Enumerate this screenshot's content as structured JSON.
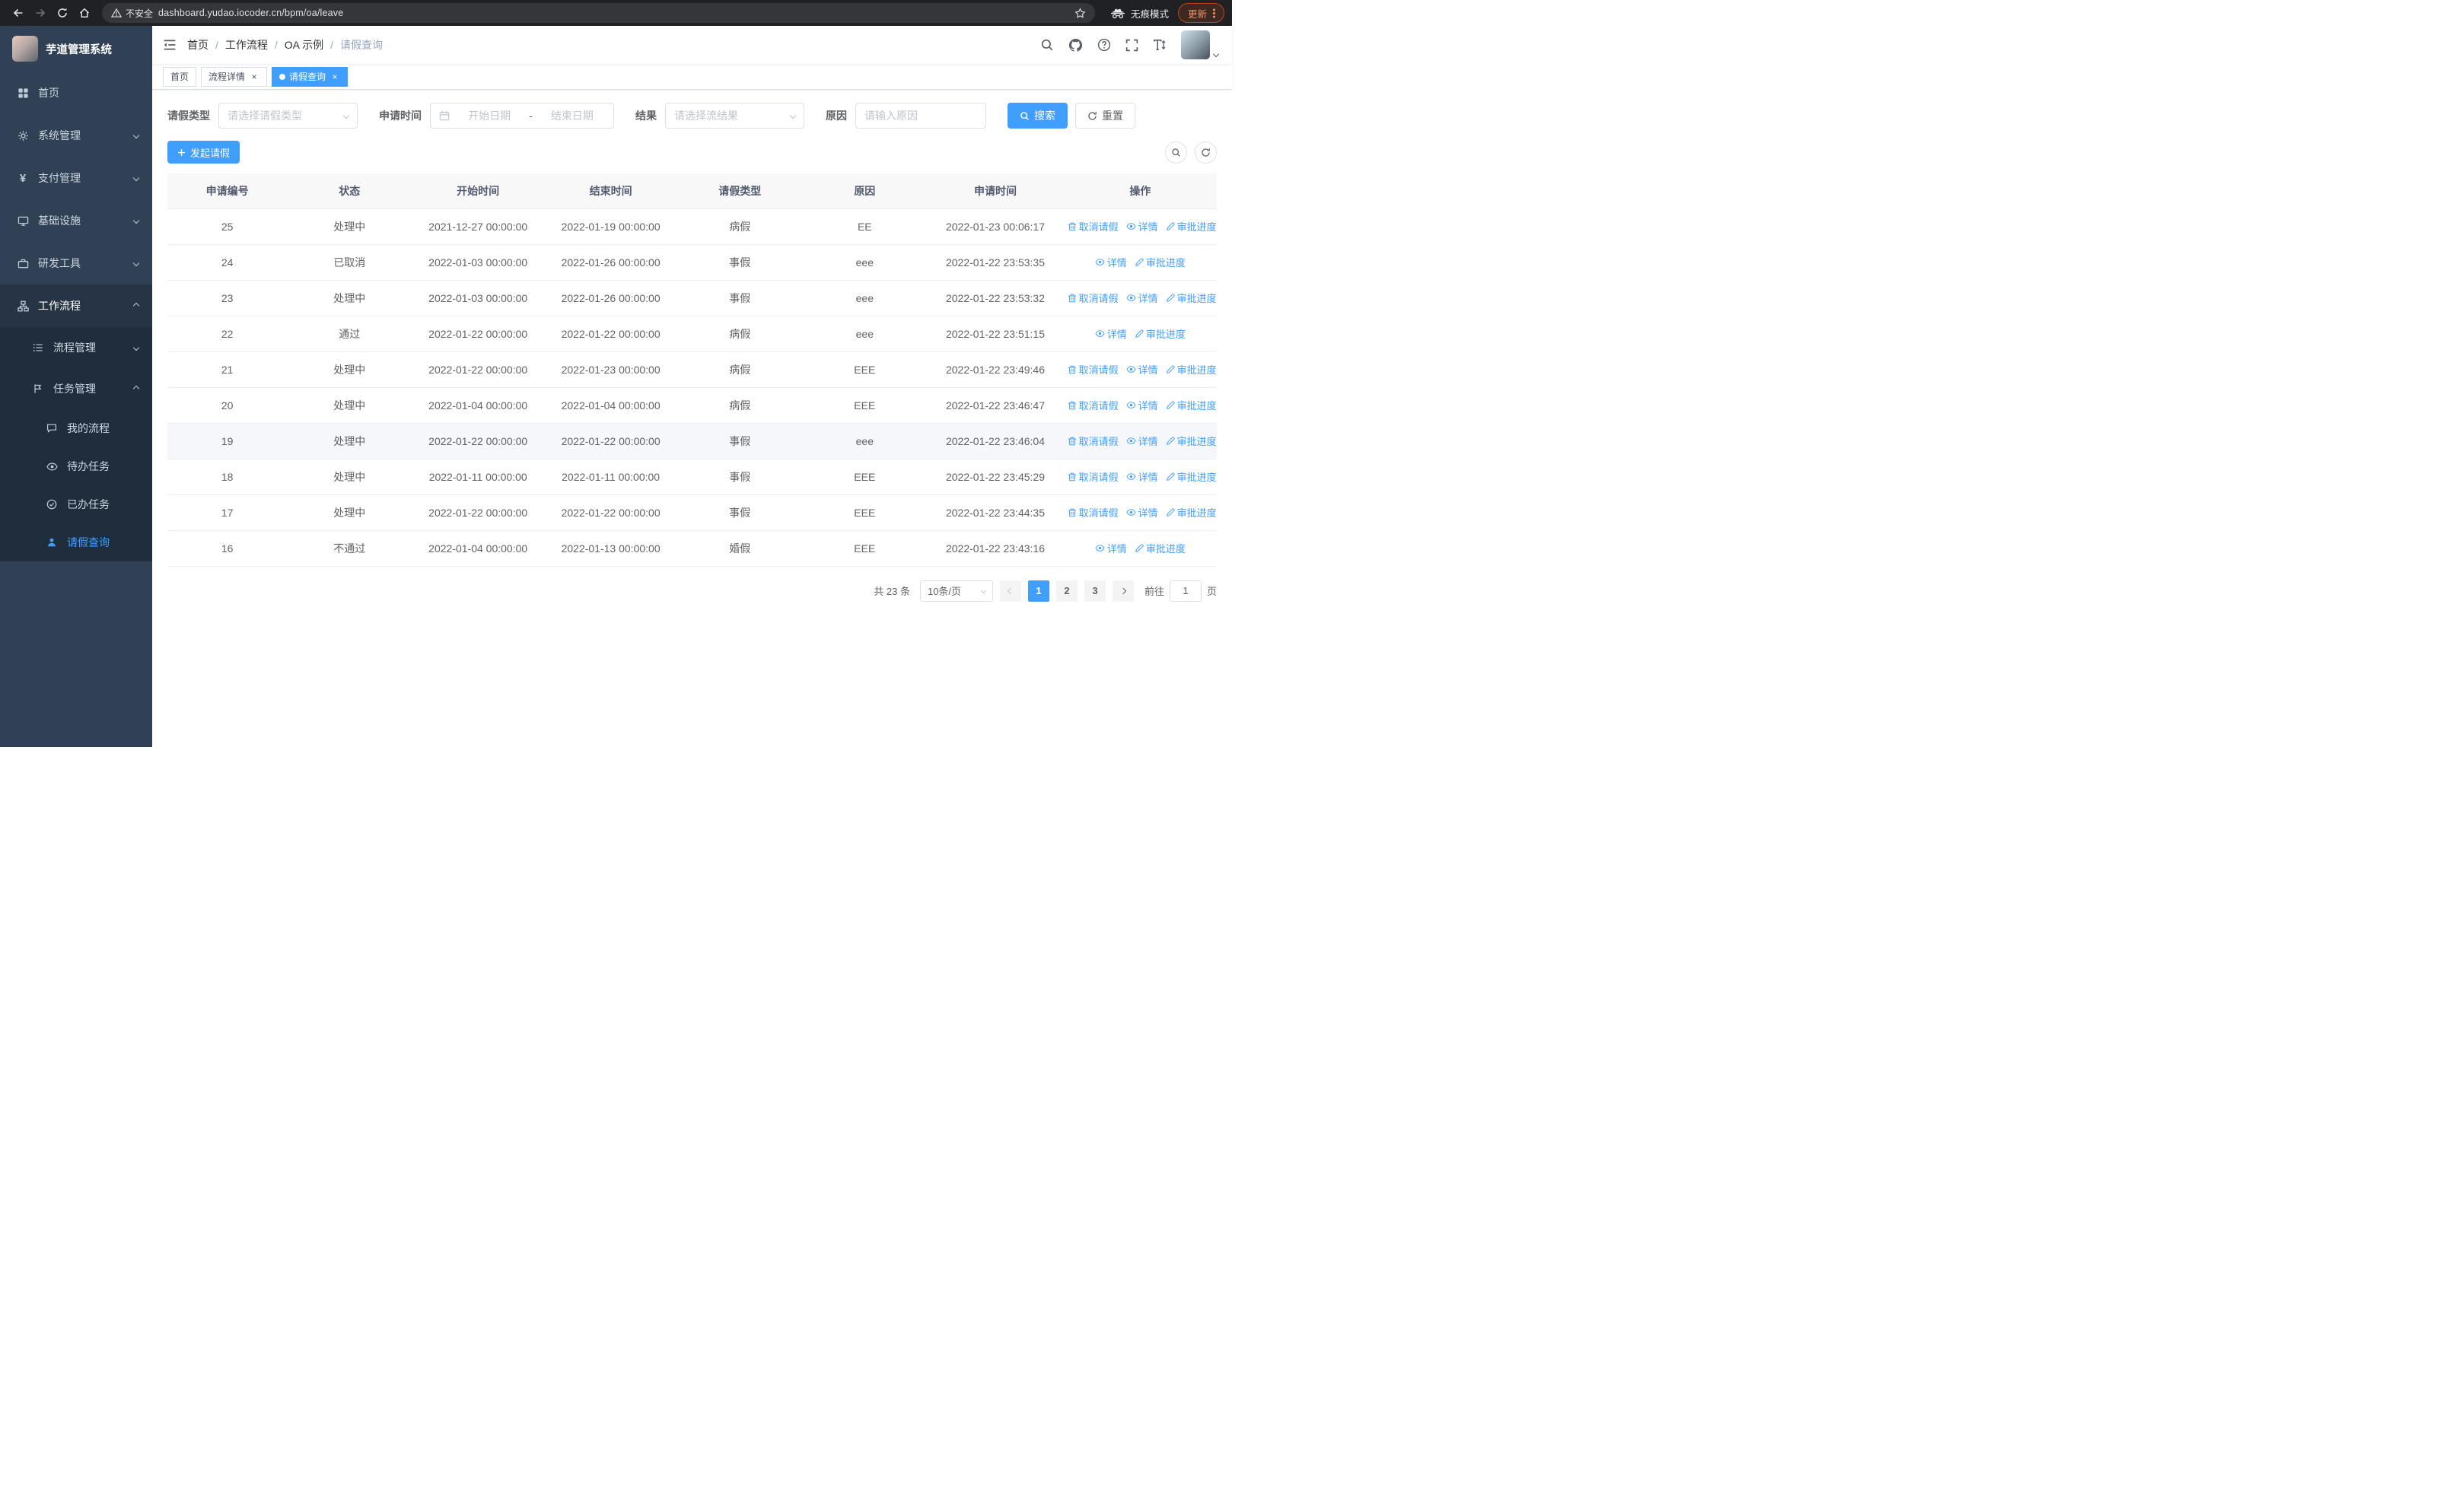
{
  "browser": {
    "security_label": "不安全",
    "url": "dashboard.yudao.iocoder.cn/bpm/oa/leave",
    "incognito_label": "无痕模式",
    "update_label": "更新"
  },
  "sidebar": {
    "logo_title": "芋道管理系统",
    "menu": [
      "首页",
      "系统管理",
      "支付管理",
      "基础设施",
      "研发工具",
      "工作流程"
    ],
    "level2": [
      "流程管理",
      "任务管理"
    ],
    "level3": [
      "我的流程",
      "待办任务",
      "已办任务",
      "请假查询"
    ]
  },
  "header": {
    "breadcrumb": [
      "首页",
      "工作流程",
      "OA 示例",
      "请假查询"
    ],
    "separator": "/"
  },
  "tabs": {
    "items": [
      "首页",
      "流程详情",
      "请假查询"
    ],
    "close_glyph": "×"
  },
  "filters": {
    "leave_type_label": "请假类型",
    "leave_type_placeholder": "请选择请假类型",
    "apply_time_label": "申请时间",
    "date_start_placeholder": "开始日期",
    "date_separator": "-",
    "date_end_placeholder": "结束日期",
    "result_label": "结果",
    "result_placeholder": "请选择流结果",
    "reason_label": "原因",
    "reason_placeholder": "请输入原因",
    "search_label": "搜索",
    "reset_label": "重置"
  },
  "toolbar": {
    "create_label": "发起请假"
  },
  "table": {
    "columns": [
      "申请编号",
      "状态",
      "开始时间",
      "结束时间",
      "请假类型",
      "原因",
      "申请时间",
      "操作"
    ],
    "action_labels": {
      "cancel": "取消请假",
      "detail": "详情",
      "progress": "审批进度"
    },
    "rows": [
      {
        "id": "25",
        "status": "处理中",
        "start": "2021-12-27 00:00:00",
        "end": "2022-01-19 00:00:00",
        "type": "病假",
        "reason": "EE",
        "applied": "2022-01-23 00:06:17",
        "actions": [
          "cancel",
          "detail",
          "progress"
        ],
        "highlighted": false
      },
      {
        "id": "24",
        "status": "已取消",
        "start": "2022-01-03 00:00:00",
        "end": "2022-01-26 00:00:00",
        "type": "事假",
        "reason": "eee",
        "applied": "2022-01-22 23:53:35",
        "actions": [
          "detail",
          "progress"
        ],
        "highlighted": false
      },
      {
        "id": "23",
        "status": "处理中",
        "start": "2022-01-03 00:00:00",
        "end": "2022-01-26 00:00:00",
        "type": "事假",
        "reason": "eee",
        "applied": "2022-01-22 23:53:32",
        "actions": [
          "cancel",
          "detail",
          "progress"
        ],
        "highlighted": false
      },
      {
        "id": "22",
        "status": "通过",
        "start": "2022-01-22 00:00:00",
        "end": "2022-01-22 00:00:00",
        "type": "病假",
        "reason": "eee",
        "applied": "2022-01-22 23:51:15",
        "actions": [
          "detail",
          "progress"
        ],
        "highlighted": false
      },
      {
        "id": "21",
        "status": "处理中",
        "start": "2022-01-22 00:00:00",
        "end": "2022-01-23 00:00:00",
        "type": "病假",
        "reason": "EEE",
        "applied": "2022-01-22 23:49:46",
        "actions": [
          "cancel",
          "detail",
          "progress"
        ],
        "highlighted": false
      },
      {
        "id": "20",
        "status": "处理中",
        "start": "2022-01-04 00:00:00",
        "end": "2022-01-04 00:00:00",
        "type": "病假",
        "reason": "EEE",
        "applied": "2022-01-22 23:46:47",
        "actions": [
          "cancel",
          "detail",
          "progress"
        ],
        "highlighted": false
      },
      {
        "id": "19",
        "status": "处理中",
        "start": "2022-01-22 00:00:00",
        "end": "2022-01-22 00:00:00",
        "type": "事假",
        "reason": "eee",
        "applied": "2022-01-22 23:46:04",
        "actions": [
          "cancel",
          "detail",
          "progress"
        ],
        "highlighted": true
      },
      {
        "id": "18",
        "status": "处理中",
        "start": "2022-01-11 00:00:00",
        "end": "2022-01-11 00:00:00",
        "type": "事假",
        "reason": "EEE",
        "applied": "2022-01-22 23:45:29",
        "actions": [
          "cancel",
          "detail",
          "progress"
        ],
        "highlighted": false
      },
      {
        "id": "17",
        "status": "处理中",
        "start": "2022-01-22 00:00:00",
        "end": "2022-01-22 00:00:00",
        "type": "事假",
        "reason": "EEE",
        "applied": "2022-01-22 23:44:35",
        "actions": [
          "cancel",
          "detail",
          "progress"
        ],
        "highlighted": false
      },
      {
        "id": "16",
        "status": "不通过",
        "start": "2022-01-04 00:00:00",
        "end": "2022-01-13 00:00:00",
        "type": "婚假",
        "reason": "EEE",
        "applied": "2022-01-22 23:43:16",
        "actions": [
          "detail",
          "progress"
        ],
        "highlighted": false
      }
    ]
  },
  "pagination": {
    "total": "共 23 条",
    "page_size": "10条/页",
    "pages": [
      "1",
      "2",
      "3"
    ],
    "goto_label": "前往",
    "goto_value": "1",
    "goto_suffix": "页"
  }
}
